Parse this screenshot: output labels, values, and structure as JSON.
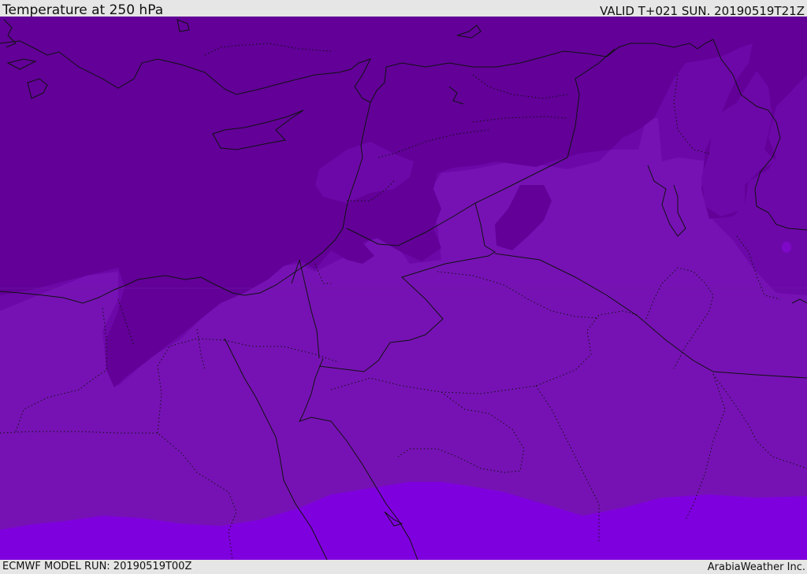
{
  "header": {
    "title": "Temperature at 250 hPa",
    "valid": "VALID T+021 SUN. 20190519T21Z"
  },
  "footer": {
    "model_run": "ECMWF MODEL RUN: 20190519T00Z",
    "credit": "ArabiaWeather Inc."
  },
  "colors": {
    "coldest": "#620098",
    "cold": "#6c08a8",
    "mid": "#7612b4",
    "warm": "#7f00de",
    "lines": "#111111"
  }
}
